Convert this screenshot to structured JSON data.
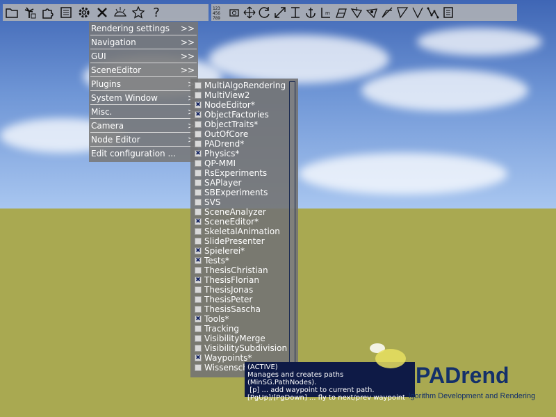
{
  "toolbar_left": [
    "folder-icon",
    "palm-icon",
    "puzzle-icon",
    "document-icon",
    "gear-icon",
    "tools-icon",
    "hedgehog-icon",
    "star-icon",
    "question-icon"
  ],
  "toolbar_right": [
    "numpad-icon",
    "camera-rotate-icon",
    "move-icon",
    "rotate-icon",
    "scale-icon",
    "align-top-icon",
    "anchor-icon",
    "measure-icon",
    "plane-icon",
    "transform-icon",
    "pan-icon",
    "path-icon",
    "triangle-icon",
    "angle-icon",
    "waypoints-icon",
    "clipboard-icon"
  ],
  "main_menu": [
    {
      "label": "Rendering settings",
      "arrow": ">>"
    },
    {
      "label": "Navigation",
      "arrow": ">>"
    },
    {
      "label": "GUI",
      "arrow": ">>"
    },
    {
      "label": "SceneEditor",
      "arrow": ">>"
    },
    {
      "label": "Plugins",
      "arrow": ">"
    },
    {
      "label": "System Window",
      "arrow": ">"
    },
    {
      "label": "Misc.",
      "arrow": ">"
    },
    {
      "label": "Camera",
      "arrow": ">"
    },
    {
      "label": "Node Editor",
      "arrow": ">"
    },
    {
      "label": "Edit configuration ...",
      "arrow": ""
    }
  ],
  "plugins": [
    {
      "label": "MultiAlgoRendering",
      "checked": false
    },
    {
      "label": "MultiView2",
      "checked": false
    },
    {
      "label": "NodeEditor*",
      "checked": true
    },
    {
      "label": "ObjectFactories",
      "checked": true
    },
    {
      "label": "ObjectTraits*",
      "checked": false
    },
    {
      "label": "OutOfCore",
      "checked": false
    },
    {
      "label": "PADrend*",
      "checked": false
    },
    {
      "label": "Physics*",
      "checked": true
    },
    {
      "label": "QP-MMI",
      "checked": false
    },
    {
      "label": "RsExperiments",
      "checked": false
    },
    {
      "label": "SAPlayer",
      "checked": false
    },
    {
      "label": "SBExperiments",
      "checked": false
    },
    {
      "label": "SVS",
      "checked": false
    },
    {
      "label": "SceneAnalyzer",
      "checked": false
    },
    {
      "label": "SceneEditor*",
      "checked": true
    },
    {
      "label": "SkeletalAnimation",
      "checked": false
    },
    {
      "label": "SlidePresenter",
      "checked": false
    },
    {
      "label": "Spielerei*",
      "checked": true
    },
    {
      "label": "Tests*",
      "checked": true
    },
    {
      "label": "ThesisChristian",
      "checked": false
    },
    {
      "label": "ThesisFlorian",
      "checked": true
    },
    {
      "label": "ThesisJonas",
      "checked": false
    },
    {
      "label": "ThesisPeter",
      "checked": false
    },
    {
      "label": "ThesisSascha",
      "checked": false
    },
    {
      "label": "Tools*",
      "checked": true
    },
    {
      "label": "Tracking",
      "checked": false
    },
    {
      "label": "VisibilityMerge",
      "checked": false
    },
    {
      "label": "VisibilitySubdivision",
      "checked": false
    },
    {
      "label": "Waypoints*",
      "checked": true
    },
    {
      "label": "Wissensch",
      "checked": false
    }
  ],
  "tooltip": {
    "line1": "(ACTIVE)",
    "line2": "Manages and creates paths (MinSG.PathNodes).",
    "line3": " [p] ... add waypoint to current path.",
    "line4": "[PgUp]/[PgDown] ... fly to next/prev waypoint"
  },
  "logo": {
    "text": "PADrend",
    "subtitle": "lgorithm Development and Rendering"
  },
  "colors": {
    "sky_top": "#3f66b5",
    "ground": "#a9a951",
    "tooltip_bg": "#0e1a46",
    "menu_bg": "#787878",
    "logo": "#14306a"
  }
}
